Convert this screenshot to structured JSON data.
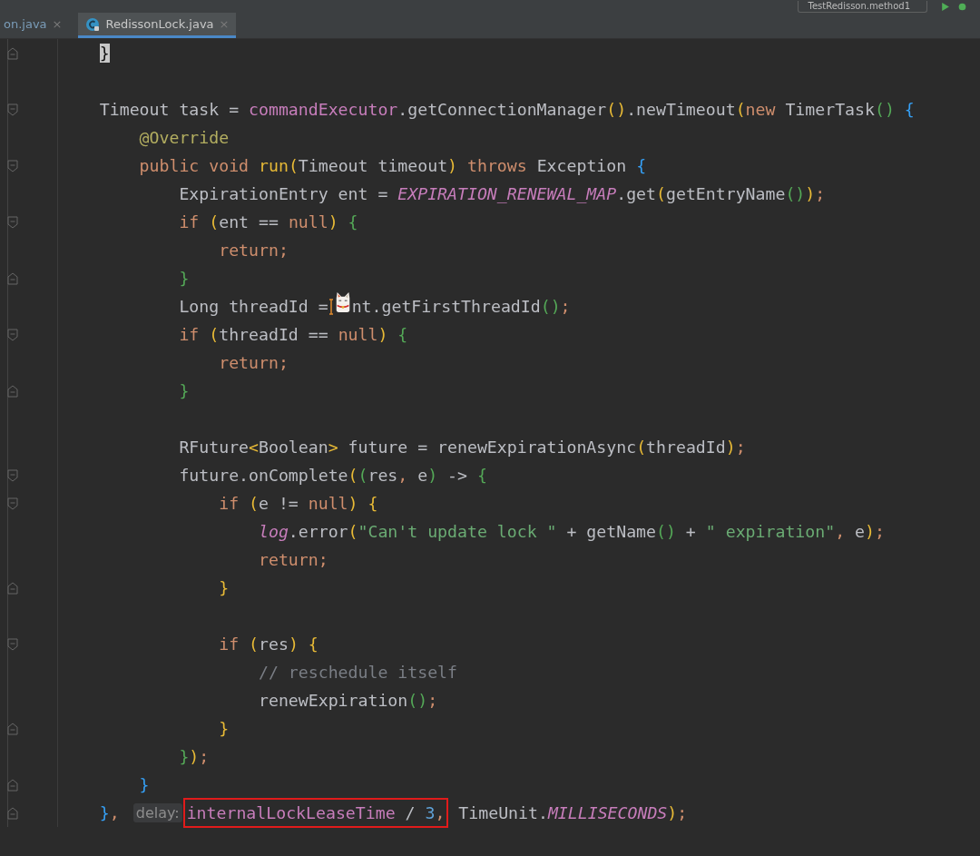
{
  "toolbar": {
    "run_config": "TestRedisson.method1"
  },
  "tabs": [
    {
      "label": "on.java",
      "selected": false,
      "file_icon": false,
      "close": "×"
    },
    {
      "label": "RedissonLock.java",
      "selected": true,
      "file_icon": true,
      "close": "×"
    }
  ],
  "editor": {
    "lines": [
      {
        "kind": "code",
        "fold": {
          "kind": "end"
        },
        "tokens": [
          {
            "text": "    }",
            "kind": "match"
          }
        ]
      },
      {
        "kind": "blank"
      },
      {
        "kind": "code",
        "fold": {
          "kind": "start"
        },
        "tokens": [
          {
            "text": "    Timeout task = ",
            "kind": "plain"
          },
          {
            "text": "commandExecutor",
            "kind": "field"
          },
          {
            "text": ".getConnectionManager",
            "kind": "plain"
          },
          {
            "text": "()",
            "kind": "p1"
          },
          {
            "text": ".newTimeout",
            "kind": "plain"
          },
          {
            "text": "(",
            "kind": "p1"
          },
          {
            "text": "new",
            "kind": "kw"
          },
          {
            "text": " TimerTask",
            "kind": "plain"
          },
          {
            "text": "()",
            "kind": "p2"
          },
          {
            "text": " {",
            "kind": "p3"
          }
        ]
      },
      {
        "kind": "code",
        "tokens": [
          {
            "text": "        @Override",
            "kind": "ann"
          }
        ]
      },
      {
        "kind": "code",
        "fold": {
          "kind": "start"
        },
        "tokens": [
          {
            "text": "        public void",
            "kind": "kw"
          },
          {
            "text": " run",
            "kind": "decl"
          },
          {
            "text": "(",
            "kind": "p1"
          },
          {
            "text": "Timeout timeout",
            "kind": "plain"
          },
          {
            "text": ")",
            "kind": "p1"
          },
          {
            "text": " throws",
            "kind": "kw"
          },
          {
            "text": " Exception ",
            "kind": "plain"
          },
          {
            "text": "{",
            "kind": "p3"
          }
        ]
      },
      {
        "kind": "code",
        "tokens": [
          {
            "text": "            ExpirationEntry ent = ",
            "kind": "plain"
          },
          {
            "text": "EXPIRATION_RENEWAL_MAP",
            "kind": "static"
          },
          {
            "text": ".get",
            "kind": "plain"
          },
          {
            "text": "(",
            "kind": "p1"
          },
          {
            "text": "getEntryName",
            "kind": "plain"
          },
          {
            "text": "()",
            "kind": "p2"
          },
          {
            "text": ")",
            "kind": "p1"
          },
          {
            "text": ";",
            "kind": "kw"
          }
        ]
      },
      {
        "kind": "code",
        "fold": {
          "kind": "start"
        },
        "tokens": [
          {
            "text": "            if",
            "kind": "kw"
          },
          {
            "text": " (",
            "kind": "p1"
          },
          {
            "text": "ent == ",
            "kind": "plain"
          },
          {
            "text": "null",
            "kind": "kw"
          },
          {
            "text": ")",
            "kind": "p1"
          },
          {
            "text": " {",
            "kind": "p2"
          }
        ]
      },
      {
        "kind": "code",
        "tokens": [
          {
            "text": "                return;",
            "kind": "kw"
          }
        ]
      },
      {
        "kind": "code",
        "fold": {
          "kind": "end"
        },
        "tokens": [
          {
            "text": "            }",
            "kind": "p2"
          }
        ]
      },
      {
        "kind": "code",
        "tokens": [
          {
            "text": "            Long threadId =",
            "kind": "plain"
          },
          {
            "kind": "sticker"
          },
          {
            "text": "nt.getFirstThreadId",
            "kind": "plain"
          },
          {
            "text": "()",
            "kind": "p2"
          },
          {
            "text": ";",
            "kind": "kw"
          }
        ]
      },
      {
        "kind": "code",
        "fold": {
          "kind": "start"
        },
        "tokens": [
          {
            "text": "            if",
            "kind": "kw"
          },
          {
            "text": " (",
            "kind": "p1"
          },
          {
            "text": "threadId == ",
            "kind": "plain"
          },
          {
            "text": "null",
            "kind": "kw"
          },
          {
            "text": ")",
            "kind": "p1"
          },
          {
            "text": " {",
            "kind": "p2"
          }
        ]
      },
      {
        "kind": "code",
        "tokens": [
          {
            "text": "                return;",
            "kind": "kw"
          }
        ]
      },
      {
        "kind": "code",
        "fold": {
          "kind": "end"
        },
        "tokens": [
          {
            "text": "            }",
            "kind": "p2"
          }
        ]
      },
      {
        "kind": "blank"
      },
      {
        "kind": "code",
        "tokens": [
          {
            "text": "            RFuture",
            "kind": "plain"
          },
          {
            "text": "<",
            "kind": "p1"
          },
          {
            "text": "Boolean",
            "kind": "plain"
          },
          {
            "text": ">",
            "kind": "p1"
          },
          {
            "text": " future = renewExpirationAsync",
            "kind": "plain"
          },
          {
            "text": "(",
            "kind": "p1"
          },
          {
            "text": "threadId",
            "kind": "plain"
          },
          {
            "text": ")",
            "kind": "p1"
          },
          {
            "text": ";",
            "kind": "kw"
          }
        ]
      },
      {
        "kind": "code",
        "fold": {
          "kind": "start"
        },
        "tokens": [
          {
            "text": "            future.onComplete",
            "kind": "plain"
          },
          {
            "text": "(",
            "kind": "p1"
          },
          {
            "text": "(",
            "kind": "p2"
          },
          {
            "text": "res",
            "kind": "plain"
          },
          {
            "text": ",",
            "kind": "kw"
          },
          {
            "text": " e",
            "kind": "plain"
          },
          {
            "text": ")",
            "kind": "p2"
          },
          {
            "text": " -> ",
            "kind": "plain"
          },
          {
            "text": "{",
            "kind": "p2"
          }
        ]
      },
      {
        "kind": "code",
        "fold": {
          "kind": "start"
        },
        "tokens": [
          {
            "text": "                if",
            "kind": "kw"
          },
          {
            "text": " (",
            "kind": "p1"
          },
          {
            "text": "e != ",
            "kind": "plain"
          },
          {
            "text": "null",
            "kind": "kw"
          },
          {
            "text": ")",
            "kind": "p1"
          },
          {
            "text": " {",
            "kind": "p1"
          }
        ]
      },
      {
        "kind": "code",
        "tokens": [
          {
            "text": "                    log",
            "kind": "static"
          },
          {
            "text": ".error",
            "kind": "plain"
          },
          {
            "text": "(",
            "kind": "p1"
          },
          {
            "text": "\"Can't update lock \"",
            "kind": "str"
          },
          {
            "text": " + getName",
            "kind": "plain"
          },
          {
            "text": "()",
            "kind": "p2"
          },
          {
            "text": " + ",
            "kind": "plain"
          },
          {
            "text": "\" expiration\"",
            "kind": "str"
          },
          {
            "text": ",",
            "kind": "kw"
          },
          {
            "text": " e",
            "kind": "plain"
          },
          {
            "text": ")",
            "kind": "p1"
          },
          {
            "text": ";",
            "kind": "kw"
          }
        ]
      },
      {
        "kind": "code",
        "tokens": [
          {
            "text": "                    return;",
            "kind": "kw"
          }
        ]
      },
      {
        "kind": "code",
        "fold": {
          "kind": "end"
        },
        "tokens": [
          {
            "text": "                }",
            "kind": "p1"
          }
        ]
      },
      {
        "kind": "blank"
      },
      {
        "kind": "code",
        "fold": {
          "kind": "start"
        },
        "tokens": [
          {
            "text": "                if",
            "kind": "kw"
          },
          {
            "text": " (",
            "kind": "p1"
          },
          {
            "text": "res",
            "kind": "plain"
          },
          {
            "text": ")",
            "kind": "p1"
          },
          {
            "text": " {",
            "kind": "p1"
          }
        ]
      },
      {
        "kind": "code",
        "tokens": [
          {
            "text": "                    // reschedule itself",
            "kind": "comment"
          }
        ]
      },
      {
        "kind": "code",
        "tokens": [
          {
            "text": "                    renewExpiration",
            "kind": "plain"
          },
          {
            "text": "()",
            "kind": "p2"
          },
          {
            "text": ";",
            "kind": "kw"
          }
        ]
      },
      {
        "kind": "code",
        "fold": {
          "kind": "end"
        },
        "tokens": [
          {
            "text": "                }",
            "kind": "p1"
          }
        ]
      },
      {
        "kind": "code",
        "tokens": [
          {
            "text": "            }",
            "kind": "p2"
          },
          {
            "text": ")",
            "kind": "p1"
          },
          {
            "text": ";",
            "kind": "kw"
          }
        ]
      },
      {
        "kind": "code",
        "fold": {
          "kind": "end"
        },
        "tokens": [
          {
            "text": "        }",
            "kind": "p3"
          }
        ]
      },
      {
        "kind": "code",
        "fold": {
          "kind": "end"
        },
        "tokens": [
          {
            "text": "    }",
            "kind": "p3"
          },
          {
            "text": ",",
            "kind": "kw"
          },
          {
            "text": "delay:",
            "kind": "hint"
          },
          {
            "kind": "boxed",
            "tokens": [
              {
                "text": "internalLockLeaseTime",
                "kind": "field"
              },
              {
                "text": " / ",
                "kind": "plain"
              },
              {
                "text": "3",
                "kind": "num"
              },
              {
                "text": ",",
                "kind": "kw"
              }
            ]
          },
          {
            "text": " TimeUnit.",
            "kind": "plain"
          },
          {
            "text": "MILLISECONDS",
            "kind": "static"
          },
          {
            "text": ")",
            "kind": "p1"
          },
          {
            "text": ";",
            "kind": "kw"
          }
        ]
      }
    ]
  }
}
